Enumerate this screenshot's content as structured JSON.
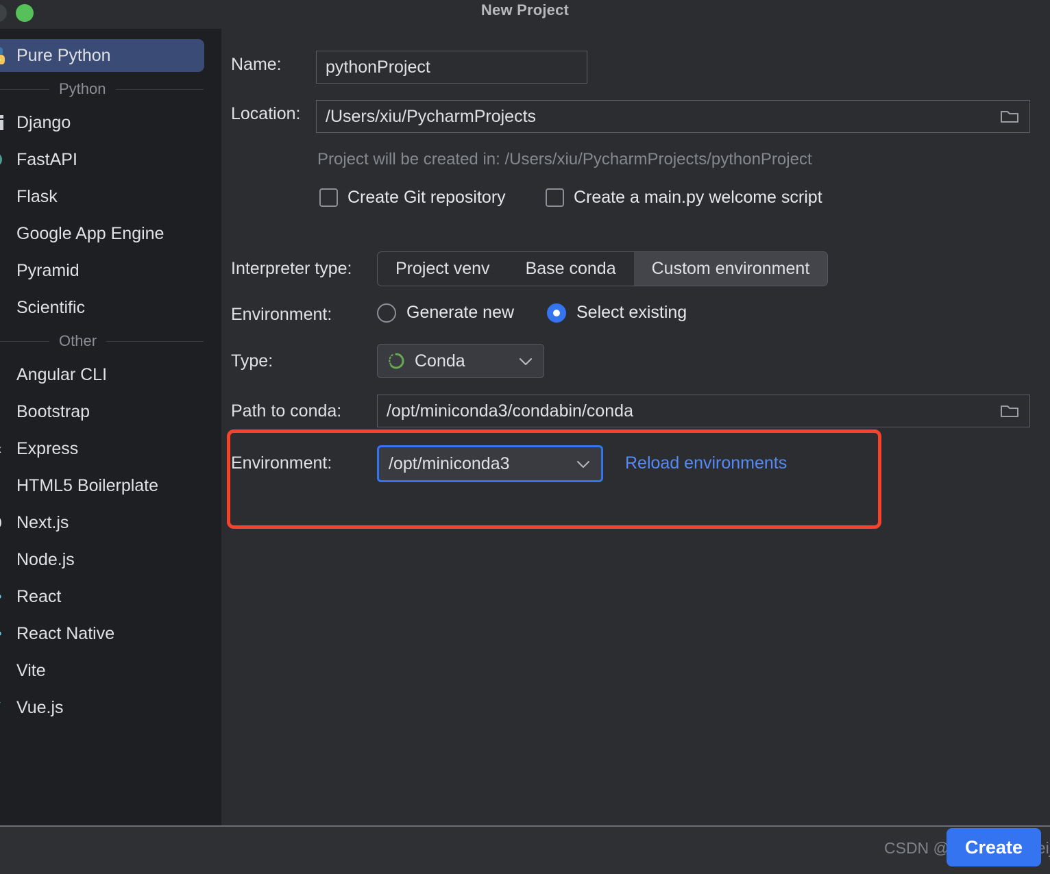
{
  "window": {
    "title": "New Project",
    "traffic_lights": [
      "close-disabled",
      "zoom-green"
    ]
  },
  "sidebar": {
    "selected": "Pure Python",
    "items": [
      {
        "label": "Pure Python",
        "icon": "python-icon",
        "selected": true,
        "type": "item"
      },
      {
        "label": "Python",
        "type": "separator"
      },
      {
        "label": "Django",
        "icon": "django-icon",
        "type": "item"
      },
      {
        "label": "FastAPI",
        "icon": "fastapi-icon",
        "type": "item"
      },
      {
        "label": "Flask",
        "icon": "flask-icon",
        "type": "item"
      },
      {
        "label": "Google App Engine",
        "icon": "google-app-engine-icon",
        "type": "item"
      },
      {
        "label": "Pyramid",
        "icon": "pyramid-icon",
        "type": "item"
      },
      {
        "label": "Scientific",
        "icon": "scientific-icon",
        "type": "item"
      },
      {
        "label": "Other",
        "type": "separator"
      },
      {
        "label": "Angular CLI",
        "icon": "angular-icon",
        "type": "item"
      },
      {
        "label": "Bootstrap",
        "icon": "bootstrap-icon",
        "type": "item"
      },
      {
        "label": "Express",
        "icon": "express-icon",
        "type": "item"
      },
      {
        "label": "HTML5 Boilerplate",
        "icon": "html5-icon",
        "type": "item"
      },
      {
        "label": "Next.js",
        "icon": "nextjs-icon",
        "type": "item"
      },
      {
        "label": "Node.js",
        "icon": "nodejs-icon",
        "type": "item"
      },
      {
        "label": "React",
        "icon": "react-icon",
        "type": "item"
      },
      {
        "label": "React Native",
        "icon": "react-native-icon",
        "type": "item"
      },
      {
        "label": "Vite",
        "icon": "vite-icon",
        "type": "item"
      },
      {
        "label": "Vue.js",
        "icon": "vuejs-icon",
        "type": "item"
      }
    ]
  },
  "form": {
    "name_label": "Name:",
    "name_value": "pythonProject",
    "name_placeholder": "pythonProject",
    "location_label": "Location:",
    "location_value": "/Users/xiu/PycharmProjects",
    "location_placeholder": "/Users/xiu/PycharmProjects",
    "location_browse_icon": "folder-icon",
    "created_in_hint": "Project will be created in: /Users/xiu/PycharmProjects/pythonProject",
    "checkboxes": [
      {
        "label": "Create Git repository",
        "checked": false
      },
      {
        "label": "Create a main.py welcome script",
        "checked": false
      }
    ],
    "interpreter_type_label": "Interpreter type:",
    "interpreter_type_options": [
      "Project venv",
      "Base conda",
      "Custom environment"
    ],
    "interpreter_type_selected": "Custom environment",
    "environment_mode_label": "Environment:",
    "environment_mode_options": [
      "Generate new",
      "Select existing"
    ],
    "environment_mode_selected": "Select existing",
    "type_label": "Type:",
    "type_value": "Conda",
    "type_icon": "conda-icon",
    "type_chevron": "chevron-down-icon",
    "path_to_conda_label": "Path to conda:",
    "path_to_conda_value": "/opt/miniconda3/condabin/conda",
    "path_to_conda_browse_icon": "folder-icon",
    "environment_label": "Environment:",
    "environment_value": "/opt/miniconda3",
    "environment_chevron": "chevron-down-icon",
    "reload_link": "Reload environments"
  },
  "footer": {
    "create_label": "Create",
    "watermark": "CSDN @liushangzaibeijing"
  },
  "colors": {
    "accent": "#3574f0",
    "link": "#548af7",
    "highlight_box": "#f5442a",
    "sidebar_selected": "#3a4c75",
    "window_bg": "#2b2d30",
    "sidebar_bg": "#1e1f22",
    "conda_green": "#6aa84f"
  }
}
